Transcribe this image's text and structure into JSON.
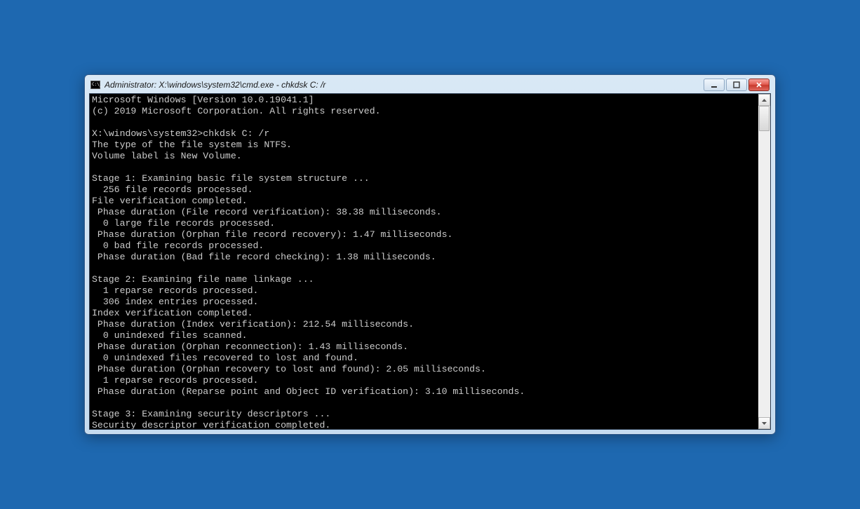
{
  "window": {
    "title": "Administrator: X:\\windows\\system32\\cmd.exe - chkdsk  C: /r"
  },
  "terminal": {
    "lines": [
      "Microsoft Windows [Version 10.0.19041.1]",
      "(c) 2019 Microsoft Corporation. All rights reserved.",
      "",
      "X:\\windows\\system32>chkdsk C: /r",
      "The type of the file system is NTFS.",
      "Volume label is New Volume.",
      "",
      "Stage 1: Examining basic file system structure ...",
      "  256 file records processed.",
      "File verification completed.",
      " Phase duration (File record verification): 38.38 milliseconds.",
      "  0 large file records processed.",
      " Phase duration (Orphan file record recovery): 1.47 milliseconds.",
      "  0 bad file records processed.",
      " Phase duration (Bad file record checking): 1.38 milliseconds.",
      "",
      "Stage 2: Examining file name linkage ...",
      "  1 reparse records processed.",
      "  306 index entries processed.",
      "Index verification completed.",
      " Phase duration (Index verification): 212.54 milliseconds.",
      "  0 unindexed files scanned.",
      " Phase duration (Orphan reconnection): 1.43 milliseconds.",
      "  0 unindexed files recovered to lost and found.",
      " Phase duration (Orphan recovery to lost and found): 2.05 milliseconds.",
      "  1 reparse records processed.",
      " Phase duration (Reparse point and Object ID verification): 3.10 milliseconds.",
      "",
      "Stage 3: Examining security descriptors ...",
      "Security descriptor verification completed."
    ]
  }
}
